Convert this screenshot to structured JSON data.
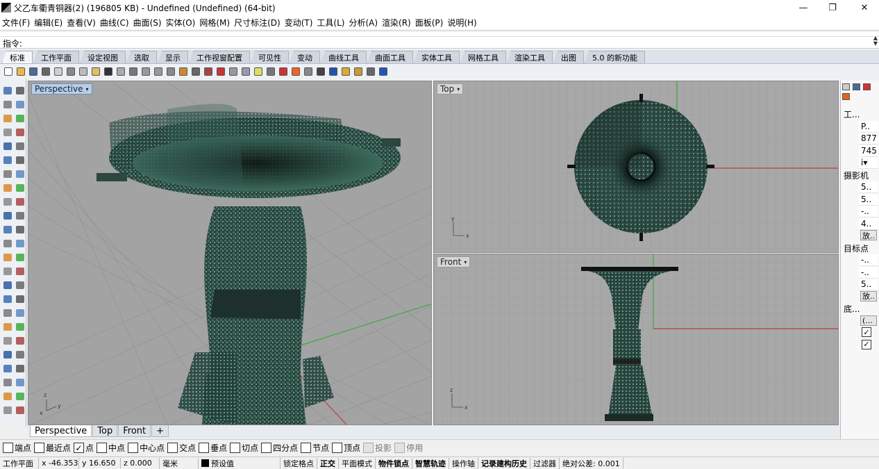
{
  "window": {
    "title": "父乙车衢青铜器(2) (196805 KB) - Undefined (Undefined) (64-bit)",
    "minimize_glyph": "—",
    "maximize_glyph": "❐",
    "close_glyph": "✕"
  },
  "menu": [
    "文件(F)",
    "编辑(E)",
    "查看(V)",
    "曲线(C)",
    "曲面(S)",
    "实体(O)",
    "网格(M)",
    "尺寸标注(D)",
    "变动(T)",
    "工具(L)",
    "分析(A)",
    "渲染(R)",
    "面板(P)",
    "说明(H)"
  ],
  "command": {
    "label": "指令:",
    "value": ""
  },
  "toolbar_tabs": [
    "标准",
    "工作平面",
    "设定视图",
    "选取",
    "显示",
    "工作视窗配置",
    "可见性",
    "变动",
    "曲线工具",
    "曲面工具",
    "实体工具",
    "网格工具",
    "渲染工具",
    "出图",
    "5.0 的新功能"
  ],
  "active_toolbar_tab": 0,
  "tool_icons": [
    {
      "name": "new-file-icon",
      "color": "#ffffff"
    },
    {
      "name": "open-folder-icon",
      "color": "#e8b84a"
    },
    {
      "name": "save-icon",
      "color": "#4a6a9a"
    },
    {
      "name": "print-icon",
      "color": "#666666"
    },
    {
      "name": "import-icon",
      "color": "#d0d0d0"
    },
    {
      "name": "cut-icon",
      "color": "#888888"
    },
    {
      "name": "copy-icon",
      "color": "#bbbbbb"
    },
    {
      "name": "paste-icon",
      "color": "#e0c060"
    },
    {
      "name": "undo-icon",
      "color": "#333333"
    },
    {
      "name": "pan-hand-icon",
      "color": "#aaaaaa"
    },
    {
      "name": "rotate-view-icon",
      "color": "#777777"
    },
    {
      "name": "zoom-icon",
      "color": "#999999"
    },
    {
      "name": "zoom-window-icon",
      "color": "#999999"
    },
    {
      "name": "zoom-extents-icon",
      "color": "#888888"
    },
    {
      "name": "zoom-selected-icon",
      "color": "#cc8a30"
    },
    {
      "name": "undo-view-icon",
      "color": "#666666"
    },
    {
      "name": "four-viewports-icon",
      "color": "#aa4444"
    },
    {
      "name": "select-icon",
      "color": "#cc3333"
    },
    {
      "name": "grid-snap-icon",
      "color": "#999999"
    },
    {
      "name": "layer-icon",
      "color": "#9999aa"
    },
    {
      "name": "light-icon",
      "color": "#dddd66"
    },
    {
      "name": "lock-icon",
      "color": "#777777"
    },
    {
      "name": "shield-icon",
      "color": "#cc3333"
    },
    {
      "name": "color-wheel-icon",
      "color": "#ee6622"
    },
    {
      "name": "material-sphere-icon",
      "color": "#888888"
    },
    {
      "name": "render-sphere-icon",
      "color": "#444444"
    },
    {
      "name": "globe-icon",
      "color": "#2255aa"
    },
    {
      "name": "options-icon",
      "color": "#ddaa33"
    },
    {
      "name": "gear-icon",
      "color": "#cc9933"
    },
    {
      "name": "plugin-icon",
      "color": "#666666"
    },
    {
      "name": "help-icon",
      "color": "#2255bb"
    }
  ],
  "left_tool_icons": [
    "select-arrow-icon",
    "point-icon",
    "line-icon",
    "polyline-icon",
    "circle-icon",
    "arc-icon",
    "ellipse-icon",
    "rectangle-icon",
    "polygon-icon",
    "curve-icon",
    "surface-icon",
    "extrude-icon",
    "box-icon",
    "sphere-icon",
    "cylinder-icon",
    "cone-icon",
    "boolean-union-icon",
    "boolean-diff-icon",
    "fillet-icon",
    "chamfer-icon",
    "mesh-icon",
    "text-icon",
    "dimension-icon",
    "move-icon",
    "rotate-icon",
    "scale-icon",
    "mirror-icon",
    "array-icon",
    "trim-icon",
    "split-icon",
    "join-icon",
    "explode-icon",
    "check-icon",
    "group-icon",
    "analyze-icon",
    "render-icon",
    "paint-icon",
    "camera-icon",
    "transform-icon",
    "hide-icon",
    "lock-icon",
    "layer-icon",
    "history-icon",
    "snap-icon",
    "grid-icon",
    "ortho-icon",
    "planar-icon",
    "osnap-icon"
  ],
  "viewports": {
    "perspective": {
      "label": "Perspective",
      "arrow": "▾"
    },
    "top": {
      "label": "Top",
      "arrow": "▾"
    },
    "front": {
      "label": "Front",
      "arrow": "▾"
    }
  },
  "axis_labels": {
    "x": "x",
    "y": "y",
    "z": "z"
  },
  "viewport_tabs": [
    "Perspective",
    "Top",
    "Front",
    "+"
  ],
  "active_viewport_tab": 0,
  "right_panel": {
    "tab_icons": [
      "display-icon",
      "camera-view-icon",
      "color-icon",
      "material-icon"
    ],
    "rows": [
      {
        "kind": "label",
        "text": "工..."
      },
      {
        "kind": "value",
        "text": "P.."
      },
      {
        "kind": "value",
        "text": "877"
      },
      {
        "kind": "value",
        "text": "745"
      },
      {
        "kind": "dropdown",
        "text": "i▾"
      },
      {
        "kind": "label",
        "text": "摄影机"
      },
      {
        "kind": "value",
        "text": "5.."
      },
      {
        "kind": "value",
        "text": "5.."
      },
      {
        "kind": "value",
        "text": "-.."
      },
      {
        "kind": "value",
        "text": "4.."
      },
      {
        "kind": "button",
        "text": "放.."
      },
      {
        "kind": "label",
        "text": "目标点"
      },
      {
        "kind": "value",
        "text": "-.."
      },
      {
        "kind": "value",
        "text": "-.."
      },
      {
        "kind": "value",
        "text": "5.."
      },
      {
        "kind": "button",
        "text": "放.."
      },
      {
        "kind": "label",
        "text": "底..."
      },
      {
        "kind": "button",
        "text": "(..."
      },
      {
        "kind": "check",
        "text": "✓"
      },
      {
        "kind": "check",
        "text": "✓"
      }
    ]
  },
  "osnaps": [
    {
      "label": "端点",
      "checked": false,
      "enabled": true
    },
    {
      "label": "最近点",
      "checked": false,
      "enabled": true
    },
    {
      "label": "点",
      "checked": true,
      "enabled": true
    },
    {
      "label": "中点",
      "checked": false,
      "enabled": true
    },
    {
      "label": "中心点",
      "checked": false,
      "enabled": true
    },
    {
      "label": "交点",
      "checked": false,
      "enabled": true
    },
    {
      "label": "垂点",
      "checked": false,
      "enabled": true
    },
    {
      "label": "切点",
      "checked": false,
      "enabled": true
    },
    {
      "label": "四分点",
      "checked": false,
      "enabled": true
    },
    {
      "label": "节点",
      "checked": false,
      "enabled": true
    },
    {
      "label": "顶点",
      "checked": false,
      "enabled": true
    },
    {
      "label": "投影",
      "checked": false,
      "enabled": false
    },
    {
      "label": "停用",
      "checked": false,
      "enabled": false
    }
  ],
  "check_glyph": "✓",
  "status": {
    "cplane": "工作平面",
    "x": "x -46.353",
    "y": "y 16.650",
    "z": "z 0.000",
    "units": "毫米",
    "layer": "预设值",
    "items": [
      {
        "text": "锁定格点",
        "bold": false
      },
      {
        "text": "正交",
        "bold": true
      },
      {
        "text": "平面模式",
        "bold": false
      },
      {
        "text": "物件锁点",
        "bold": true
      },
      {
        "text": "智慧轨迹",
        "bold": true
      },
      {
        "text": "操作轴",
        "bold": false
      },
      {
        "text": "记录建构历史",
        "bold": true
      },
      {
        "text": "过滤器",
        "bold": false
      },
      {
        "text": "绝对公差: 0.001",
        "bold": false
      }
    ]
  },
  "colors": {
    "bronze_dark": "#1e2e2a",
    "bronze_mid": "#2f4a42",
    "patina": "#4f8a78",
    "viewport_bg": "#a3a3a3",
    "x_axis": "#b84040",
    "y_axis": "#3fa83f"
  }
}
